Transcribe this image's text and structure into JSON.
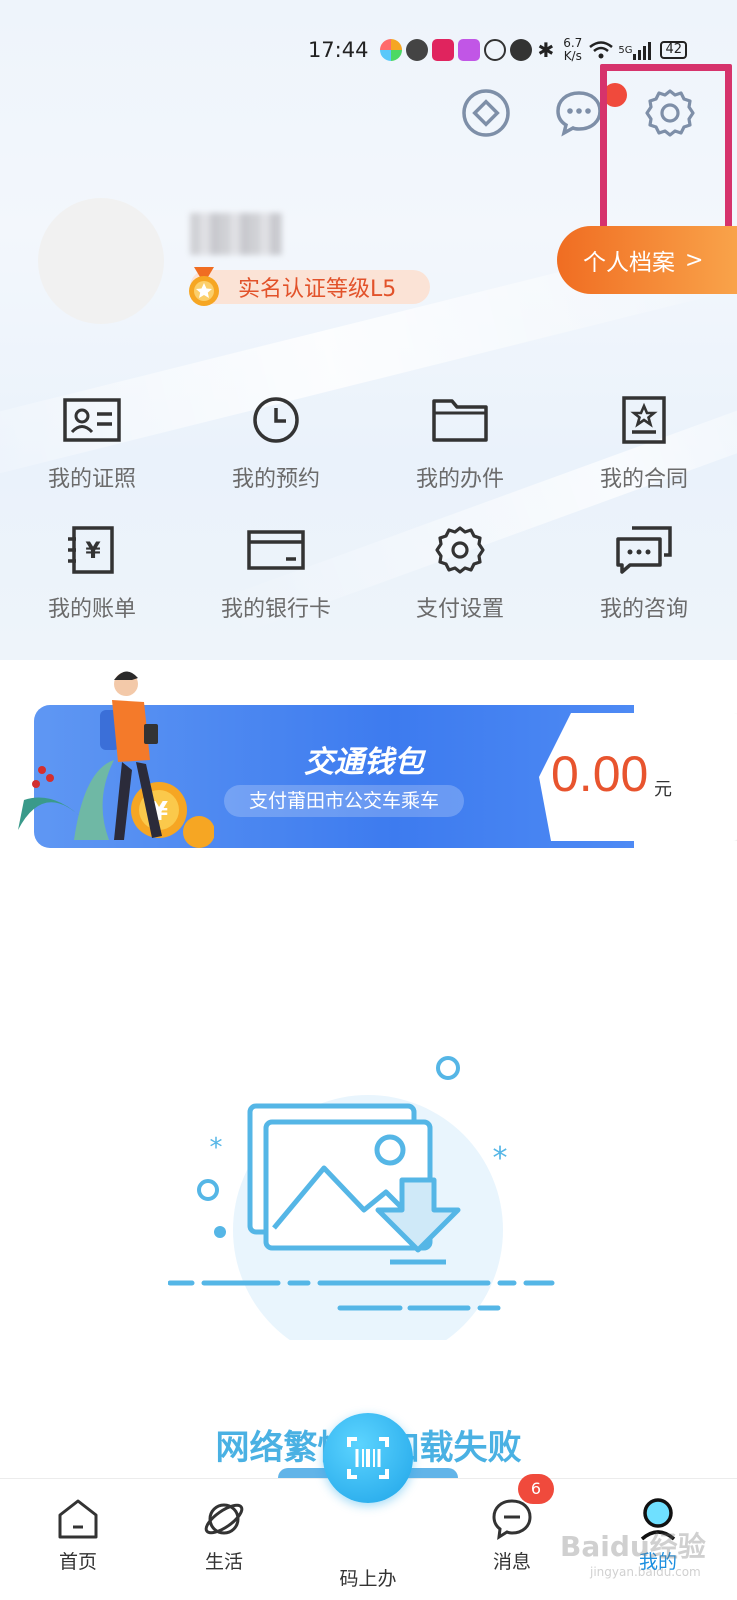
{
  "status_bar": {
    "time": "17:44",
    "net_speed_value": "6.7",
    "net_speed_unit": "K/s",
    "battery": "42",
    "network": "5G"
  },
  "profile": {
    "level_badge": "实名认证等级L5",
    "archive_button": "个人档案"
  },
  "grid": [
    {
      "label": "我的证照",
      "icon": "id-card-icon"
    },
    {
      "label": "我的预约",
      "icon": "clock-icon"
    },
    {
      "label": "我的办件",
      "icon": "folder-icon"
    },
    {
      "label": "我的合同",
      "icon": "contract-icon"
    },
    {
      "label": "我的账单",
      "icon": "bill-icon"
    },
    {
      "label": "我的银行卡",
      "icon": "bank-card-icon"
    },
    {
      "label": "支付设置",
      "icon": "gear-icon"
    },
    {
      "label": "我的咨询",
      "icon": "chat-icon"
    }
  ],
  "wallet": {
    "title": "交通钱包",
    "subtitle": "支付莆田市公交车乘车",
    "amount": "0.00",
    "unit": "元"
  },
  "error": {
    "message": "网络繁忙，加载失败"
  },
  "nav": {
    "home": "首页",
    "life": "生活",
    "scan": "码上办",
    "messages": "消息",
    "messages_badge": "6",
    "mine": "我的"
  },
  "watermark": {
    "text": "Baidu经验",
    "sub": "jingyan.baidu.com"
  },
  "colors": {
    "accent_orange": "#f06d22",
    "accent_blue": "#3d7bef",
    "highlight": "#d6336c",
    "error_text": "#4ab1e3",
    "badge_red": "#f04a3c"
  }
}
